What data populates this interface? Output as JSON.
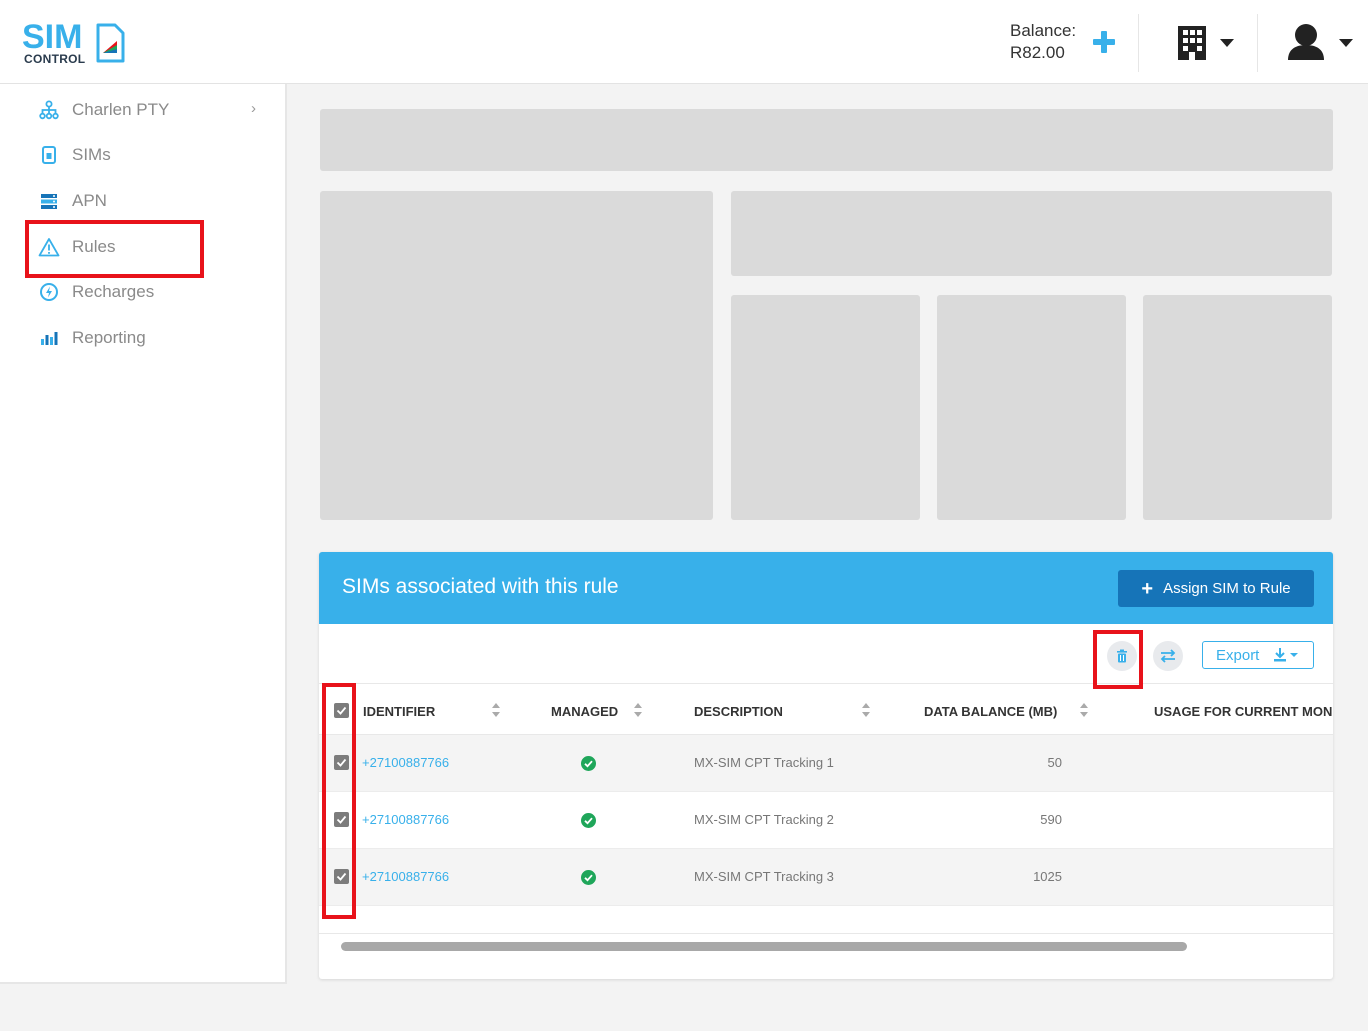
{
  "header": {
    "logo_sim": "SIM",
    "logo_control": "CONTROL",
    "balance_label": "Balance:",
    "balance_value": "R82.00",
    "icons": [
      "plus-icon",
      "building-icon",
      "user-icon",
      "caret-down-icon"
    ]
  },
  "sidebar": {
    "items": [
      {
        "label": "Charlen PTY",
        "icon": "org-tree-icon"
      },
      {
        "label": "SIMs",
        "icon": "sim-card-icon"
      },
      {
        "label": "APN",
        "icon": "server-icon"
      },
      {
        "label": "Rules",
        "icon": "warning-icon"
      },
      {
        "label": "Recharges",
        "icon": "bolt-circle-icon"
      },
      {
        "label": "Reporting",
        "icon": "bar-chart-icon"
      }
    ]
  },
  "panel": {
    "title": "SIMs associated with this rule",
    "assign_label": "Assign SIM to Rule",
    "export_label": "Export",
    "columns": [
      "IDENTIFIER",
      "MANAGED",
      "DESCRIPTION",
      "DATA BALANCE (MB)",
      "USAGE FOR CURRENT MON"
    ],
    "rows": [
      {
        "identifier": "+27100887766",
        "managed": true,
        "description": "MX-SIM CPT Tracking 1",
        "data_balance": "50"
      },
      {
        "identifier": "+27100887766",
        "managed": true,
        "description": "MX-SIM CPT Tracking 2",
        "data_balance": "590"
      },
      {
        "identifier": "+27100887766",
        "managed": true,
        "description": "MX-SIM CPT Tracking 3",
        "data_balance": "1025"
      }
    ]
  },
  "colors": {
    "accent": "#38b0ea",
    "button_dark": "#1674b8",
    "highlight": "#e8121a",
    "success": "#1fa65a"
  }
}
